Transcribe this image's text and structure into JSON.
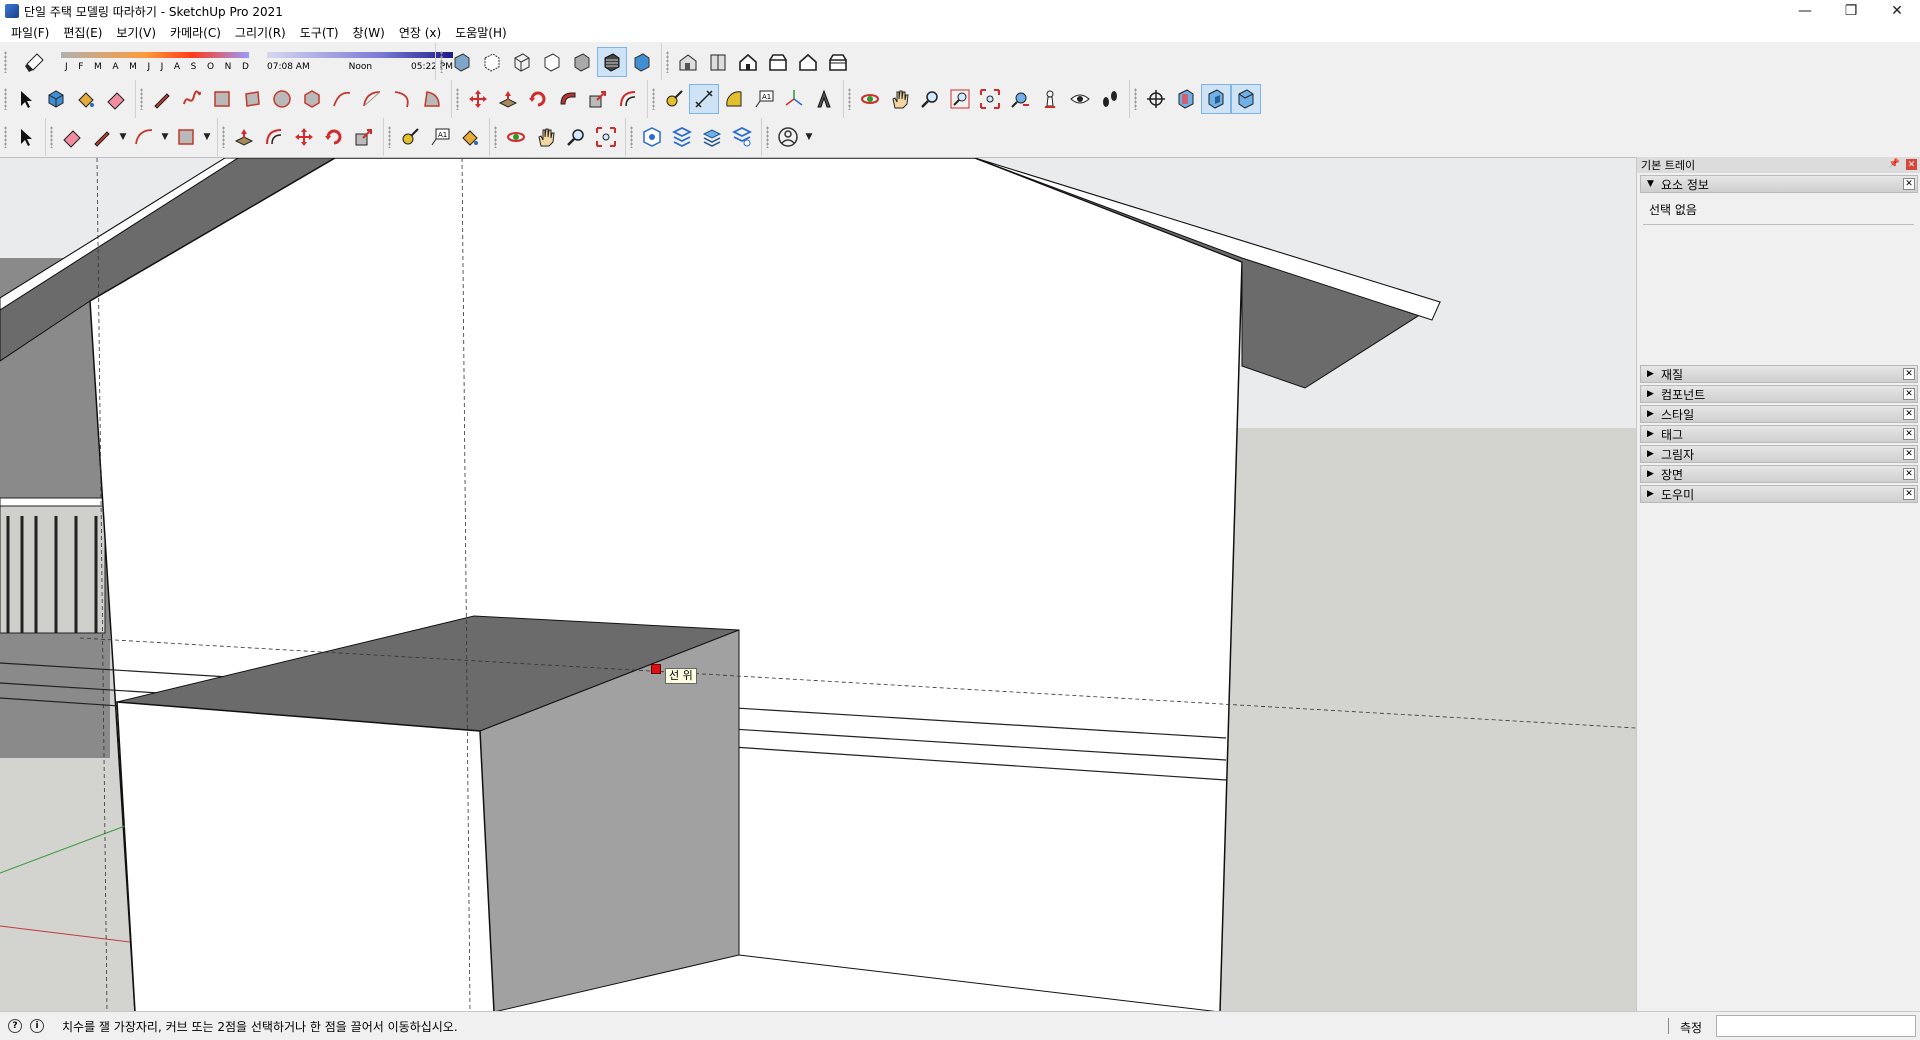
{
  "window": {
    "title": "단일 주택 모델링 따라하기 - SketchUp Pro 2021",
    "minimize": "—",
    "restore": "❐",
    "close": "✕"
  },
  "menu": [
    "파일(F)",
    "편집(E)",
    "보기(V)",
    "카메라(C)",
    "그리기(R)",
    "도구(T)",
    "창(W)",
    "연장 (x)",
    "도움말(H)"
  ],
  "shadow_settings": {
    "months": [
      "J",
      "F",
      "M",
      "A",
      "M",
      "J",
      "J",
      "A",
      "S",
      "O",
      "N",
      "D"
    ],
    "time_start": "07:08 AM",
    "time_mid": "Noon",
    "time_end": "05:22 PM"
  },
  "viewport": {
    "inference_tooltip": "선 위"
  },
  "tray": {
    "title": "기본 트레이",
    "entity_info": {
      "label": "요소 정보",
      "selection": "선택 없음"
    },
    "panels": [
      "재질",
      "컴포넌트",
      "스타일",
      "태그",
      "그림자",
      "장면",
      "도우미"
    ]
  },
  "status": {
    "message": "치수를 잴 가장자리, 커브 또는 2점을 선택하거나 한 점을 끌어서 이동하십시오.",
    "measurements_label": "측정",
    "measurements_value": ""
  },
  "colors": {
    "wall_face": "#ffffff",
    "shaded_face": "#9e9e9e",
    "dark_face": "#6b6b6b",
    "ground": "#d3d3cf",
    "sky": "#e8eaec",
    "snap_red": "#dd1111"
  }
}
